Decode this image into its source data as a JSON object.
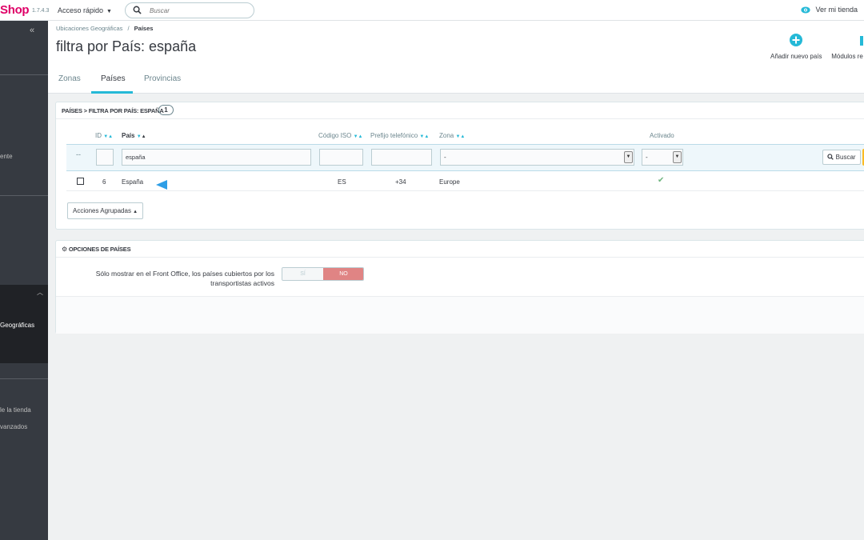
{
  "header": {
    "logo": "Shop",
    "version": "1.7.4.3",
    "quick_access": "Acceso rápido",
    "search_placeholder": "Buscar",
    "view_store": "Ver mi tienda"
  },
  "sidebar": {
    "collapse": "«",
    "items": [
      {
        "label": "ente"
      },
      {
        "label": "Geográficas"
      },
      {
        "label": "le la tienda"
      },
      {
        "label": "vanzados"
      }
    ]
  },
  "breadcrumb": {
    "parent": "Ubicaciones Geográficas",
    "separator": "/",
    "current": "Países"
  },
  "page_title": "filtra por País: españa",
  "toolbar": {
    "add_country": "Añadir nuevo país",
    "modules": "Módulos re"
  },
  "tabs": [
    {
      "label": "Zonas"
    },
    {
      "label": "Países"
    },
    {
      "label": "Provincias"
    }
  ],
  "list_panel": {
    "title": "Países > Filtra por País: españa",
    "count": "1",
    "columns": {
      "id": "ID",
      "country": "País",
      "iso": "Código ISO",
      "prefix": "Prefijo telefónico",
      "zone": "Zona",
      "active": "Activado"
    },
    "filters": {
      "dash": "--",
      "country_value": "españa",
      "zone_value": "-",
      "active_value": "-",
      "search_button": "Buscar"
    },
    "rows": [
      {
        "id": "6",
        "country": "España",
        "iso": "ES",
        "prefix": "+34",
        "zone": "Europe",
        "active": true
      }
    ],
    "bulk_actions": "Acciones Agrupadas"
  },
  "options_panel": {
    "title": "Opciones de países",
    "option_label": "Sólo mostrar en el Front Office, los países cubiertos por los transportistas activos",
    "yes": "SÍ",
    "no": "NO"
  },
  "colors": {
    "brand": "#df0067",
    "accent": "#25b9d7",
    "sidebar": "#363a41",
    "no_active": "#e08484",
    "check": "#70b580"
  }
}
